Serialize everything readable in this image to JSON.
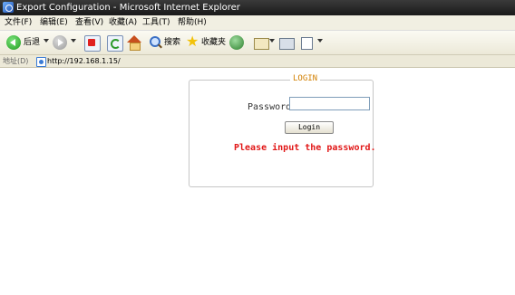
{
  "window": {
    "title": "Export Configuration - Microsoft Internet Explorer"
  },
  "menu": {
    "items": [
      "文件(F)",
      "编辑(E)",
      "查看(V)",
      "收藏(A)",
      "工具(T)",
      "帮助(H)"
    ]
  },
  "toolbar": {
    "back_label": "后退",
    "search_label": "搜索",
    "favorites_label": "收藏夹"
  },
  "address": {
    "label": "地址(D)",
    "url": "http://192.168.1.15/"
  },
  "login": {
    "legend": "LOGIN",
    "password_label": "Password:",
    "password_value": "",
    "button_label": "Login",
    "message": "Please input the password."
  }
}
